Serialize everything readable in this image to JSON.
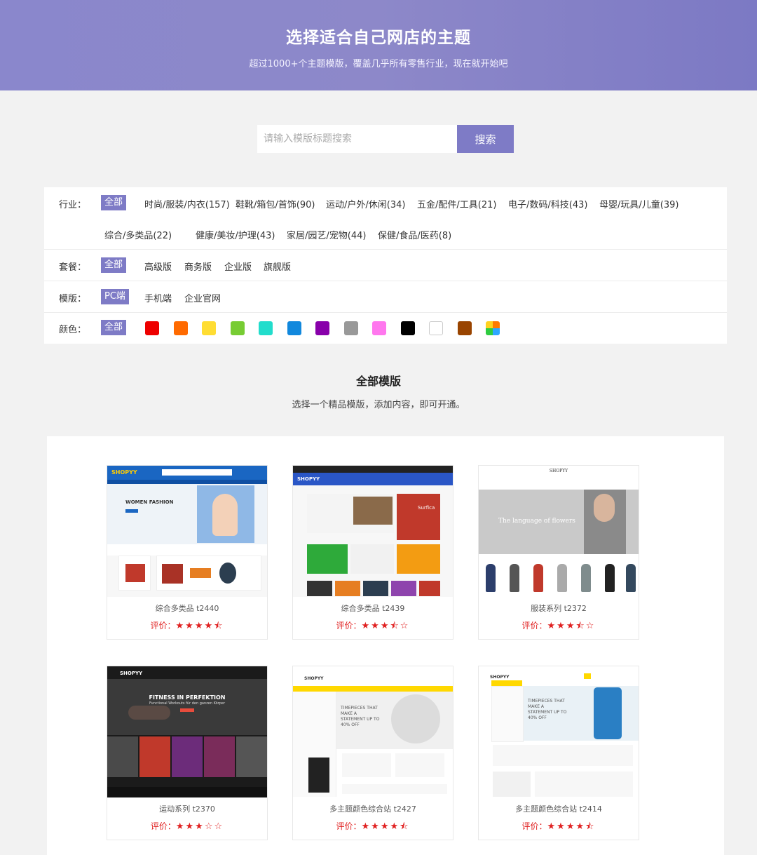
{
  "hero": {
    "title": "选择适合自己网店的主题",
    "subtitle": "超过1000+个主题模版，覆盖几乎所有零售行业，现在就开始吧"
  },
  "search": {
    "placeholder": "请输入模版标题搜索",
    "button": "搜索"
  },
  "filters": {
    "industry": {
      "label": "行业：",
      "items": [
        "全部",
        "时尚/服装/内衣(157)",
        "鞋靴/箱包/首饰(90)",
        "运动/户外/休闲(34)",
        "五金/配件/工具(21)",
        "电子/数码/科技(43)",
        "母婴/玩具/儿童(39)",
        "综合/多类品(22)",
        "健康/美妆/护理(43)",
        "家居/园艺/宠物(44)",
        "保健/食品/医药(8)"
      ]
    },
    "package": {
      "label": "套餐：",
      "items": [
        "全部",
        "高级版",
        "商务版",
        "企业版",
        "旗舰版"
      ]
    },
    "template": {
      "label": "模版：",
      "items": [
        "PC端",
        "手机端",
        "企业官网"
      ]
    },
    "color": {
      "label": "颜色：",
      "all": "全部",
      "swatches": [
        "#ee0000",
        "#ff6a00",
        "#ffdd33",
        "#77cc33",
        "#22ddcc",
        "#1188dd",
        "#8800aa",
        "#999999",
        "#ff77ee",
        "#000000",
        "#ffffff",
        "#994400",
        "multi"
      ]
    }
  },
  "section": {
    "title": "全部模版",
    "subtitle": "选择一个精品模版，添加内容，即可开通。"
  },
  "cards": [
    {
      "name": "综合多类品 t2440",
      "rating_label": "评价：",
      "stars": "★★★★⯪"
    },
    {
      "name": "综合多类品 t2439",
      "rating_label": "评价：",
      "stars": "★★★⯪☆"
    },
    {
      "name": "服装系列 t2372",
      "rating_label": "评价：",
      "stars": "★★★⯪☆"
    },
    {
      "name": "运动系列 t2370",
      "rating_label": "评价：",
      "stars": "★★★☆☆"
    },
    {
      "name": "多主题颜色综合站 t2427",
      "rating_label": "评价：",
      "stars": "★★★★⯪"
    },
    {
      "name": "多主题颜色综合站 t2414",
      "rating_label": "评价：",
      "stars": "★★★★⯪"
    }
  ],
  "thumbs": {
    "t2440_banner": "WOMEN FASHION",
    "t2440_logo": "SHOPYY",
    "t2439_logo": "SHOPYY",
    "t2439_promo": "Surfica",
    "t2372_logo": "SHOPYY",
    "t2372_banner": "The language of flowers",
    "t2370_logo": "SHOPYY",
    "t2370_banner": "FITNESS IN PERFEKTION",
    "t2370_sub": "Functional Workouts für den ganzen Körper",
    "t2427_logo": "SHOPYY",
    "t2427_banner": "TIMEPIECES THAT MAKE A STATEMENT UP TO 40% OFF",
    "t2414_logo": "SHOPYY",
    "t2414_banner": "TIMEPIECES THAT MAKE A STATEMENT UP TO 40% OFF"
  }
}
